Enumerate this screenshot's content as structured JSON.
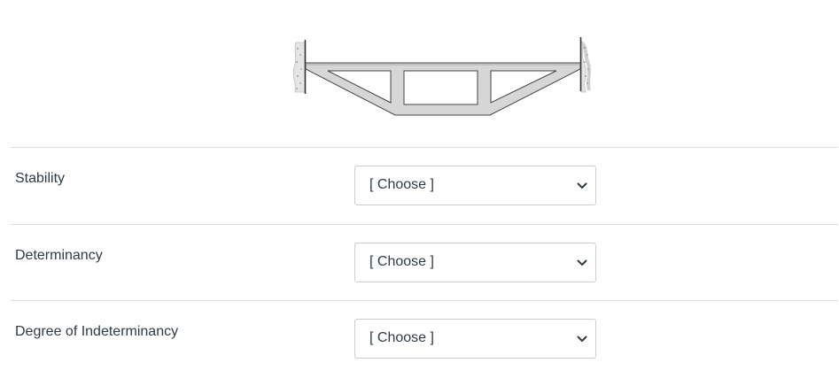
{
  "figure": {
    "icon": "truss-diagram-icon"
  },
  "questions": [
    {
      "label": "Stability",
      "dropdown": {
        "selected": "[ Choose ]",
        "icon": "chevron-down-icon"
      }
    },
    {
      "label": "Determinancy",
      "dropdown": {
        "selected": "[ Choose ]",
        "icon": "chevron-down-icon"
      }
    },
    {
      "label": "Degree of Indeterminancy",
      "dropdown": {
        "selected": "[ Choose ]",
        "icon": "chevron-down-icon"
      }
    }
  ],
  "colors": {
    "text": "#2d3b45",
    "divider": "#d9dde0",
    "input_border": "#c7cdd1",
    "truss_fill": "#d6d6d6",
    "truss_stroke": "#444444"
  }
}
